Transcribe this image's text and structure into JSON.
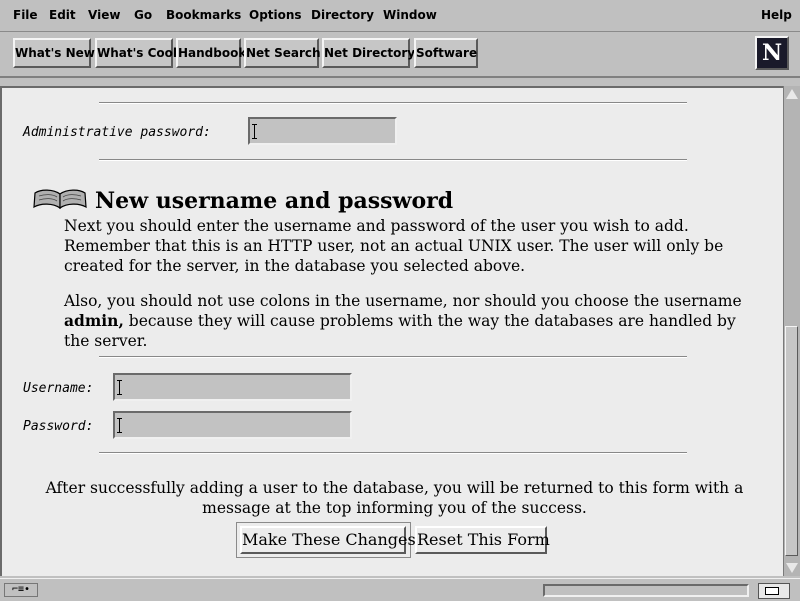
{
  "menu": [
    "File",
    "Edit",
    "View",
    "Go",
    "Bookmarks",
    "Options",
    "Directory",
    "Window",
    "Help"
  ],
  "toolbar": [
    "What's New",
    "What's Cool",
    "Handbook",
    "Net Search",
    "Net Directory",
    "Software"
  ],
  "logo_letter": "N",
  "admin": {
    "label": "Administrative password:",
    "value": ""
  },
  "section": {
    "heading": "New username and password",
    "para1": "Next you should enter the username and password of the user you wish to add. Remember that this is an HTTP user, not an actual UNIX user. The user will only be created for the server, in the database you selected above.",
    "para2_before": "Also, you should not use colons in the username, nor should you choose the username ",
    "para2_bold": "admin,",
    "para2_after": " because they will cause problems with the way the databases are handled by the server."
  },
  "username": {
    "label": "Username:",
    "value": ""
  },
  "password": {
    "label": "Password:",
    "value": ""
  },
  "info_text": "After successfully adding a user to the database, you will be returned to this form with a message at the top informing you of the success.",
  "buttons": {
    "submit": "Make These Changes",
    "reset": "Reset This Form"
  },
  "status": {
    "security_icon": "⌐≡∙"
  }
}
